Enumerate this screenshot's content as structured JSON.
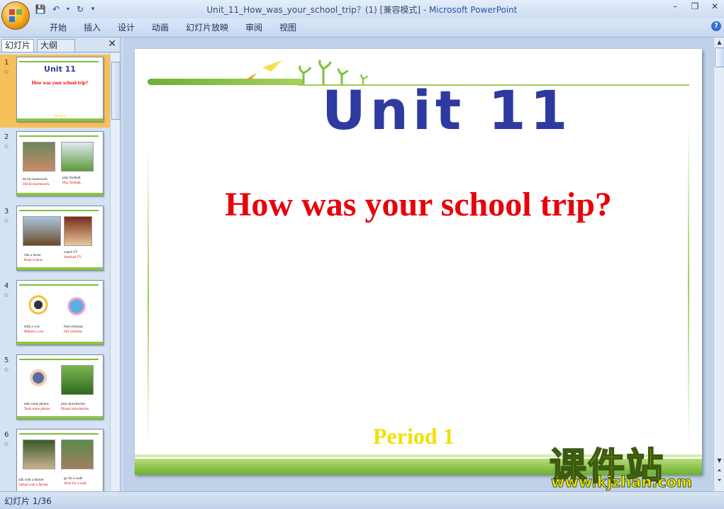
{
  "window": {
    "title_doc": "Unit_11_How_was_your_school_trip？(1) [兼容模式] - ",
    "title_app": "Microsoft PowerPoint"
  },
  "ribbon": {
    "tabs": [
      "开始",
      "插入",
      "设计",
      "动画",
      "幻灯片放映",
      "审阅",
      "视图"
    ]
  },
  "pane": {
    "tab_slides": "幻灯片",
    "tab_outline": "大纲",
    "close": "✕"
  },
  "thumbnails": [
    {
      "num": "1",
      "title": "Unit 11",
      "subtitle": "How was your school trip?",
      "period": "Period 1"
    },
    {
      "num": "2",
      "left_cap1": "do his homework.",
      "left_cap2": "Did his homework.",
      "right_cap1": "play football.",
      "right_cap2": "Play football."
    },
    {
      "num": "3",
      "left_cap1": "ride a horse.",
      "left_cap2": "Rode a horse",
      "right_cap1": "watch TV",
      "right_cap2": "Watched TV"
    },
    {
      "num": "4",
      "left_cap1": "milk a cow",
      "left_cap2": "Milked a cow",
      "right_cap1": "feed chickens",
      "right_cap2": "Fed chickens"
    },
    {
      "num": "5",
      "left_cap1": "take some photos",
      "left_cap2": "Took some photos",
      "right_cap1": "pick strawberries",
      "right_cap2": "Picked strawberries"
    },
    {
      "num": "6",
      "left_cap1": "talk with a farmer",
      "left_cap2": "Talked with a farmer",
      "right_cap1": "go for a walk",
      "right_cap2": "Went for a walk"
    }
  ],
  "slide": {
    "title": "Unit  11",
    "subtitle": "How was your school trip?",
    "period": "Period 1"
  },
  "watermark": {
    "cn": "课件站",
    "url": "www.kjzhan.com"
  },
  "status": {
    "slide_count": "幻灯片 1/36"
  },
  "colors": {
    "title_blue": "#2e3aa0",
    "subtitle_red": "#e8000b",
    "period_yellow": "#f0e000",
    "accent_green": "#7cc03a"
  }
}
